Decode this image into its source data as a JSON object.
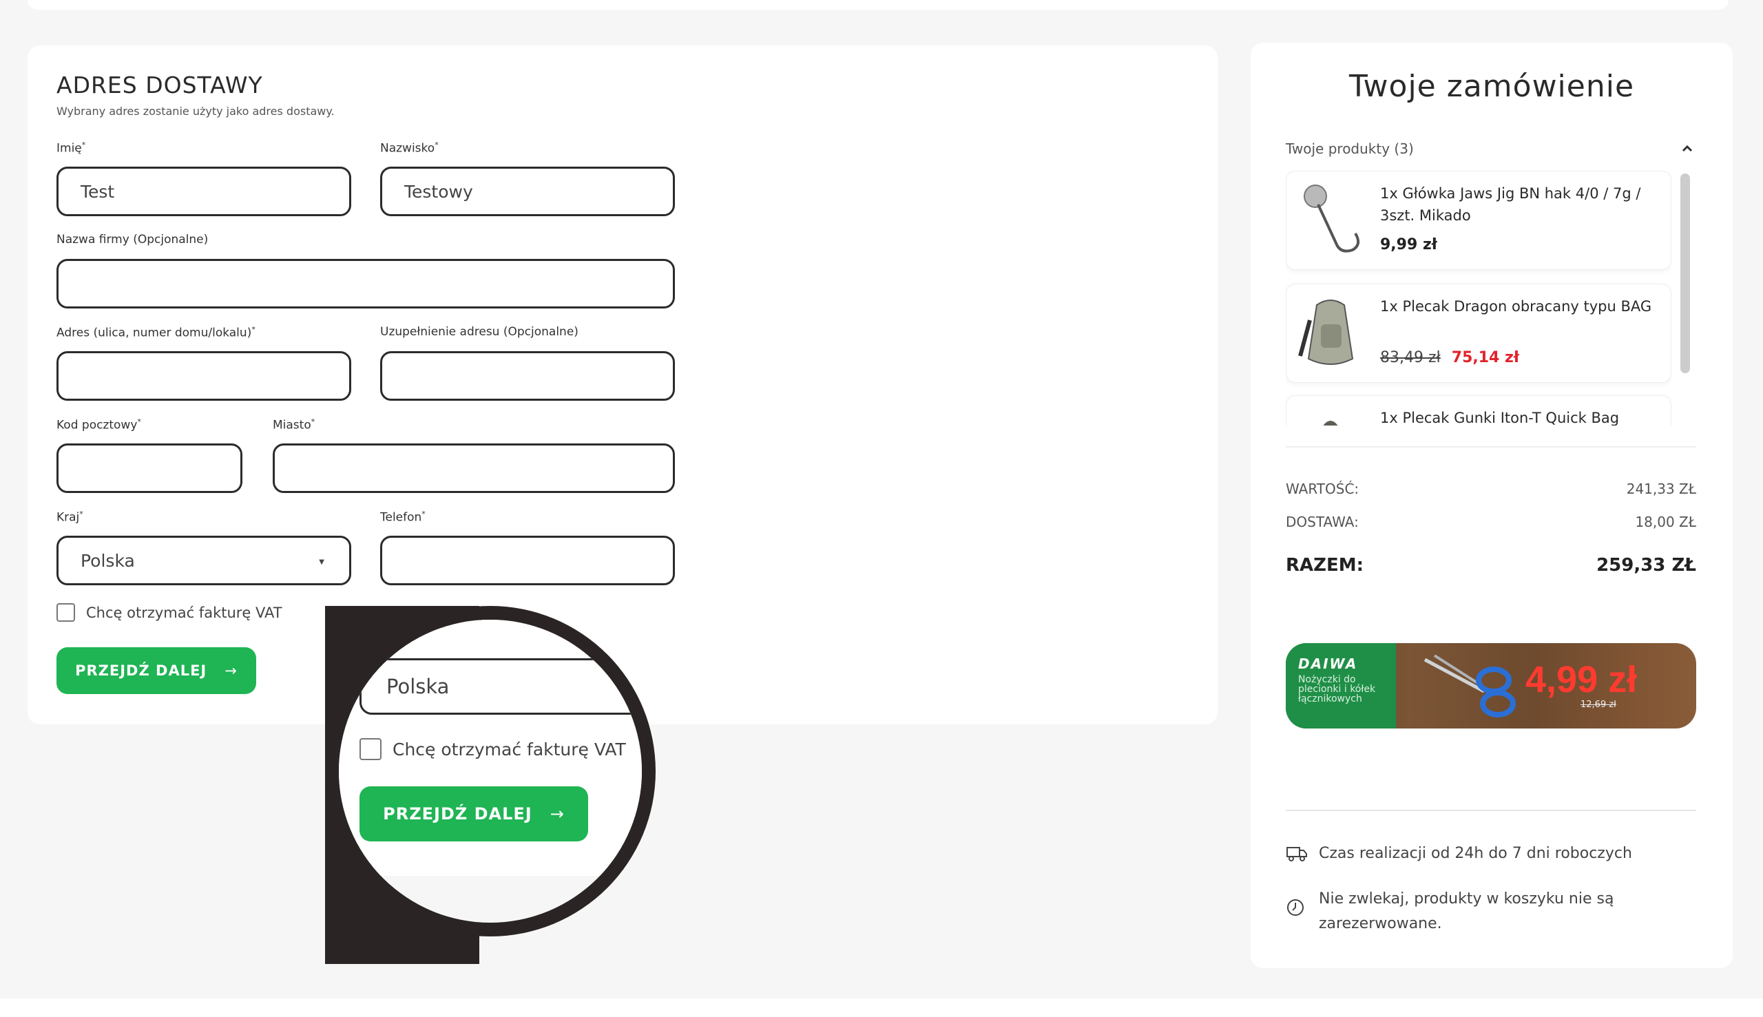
{
  "form": {
    "title": "ADRES DOSTAWY",
    "subtitle": "Wybrany adres zostanie użyty jako adres dostawy.",
    "fields": {
      "first_name": {
        "label": "Imię",
        "value": "Test"
      },
      "last_name": {
        "label": "Nazwisko",
        "value": "Testowy"
      },
      "company": {
        "label": "Nazwa firmy (Opcjonalne)",
        "value": ""
      },
      "address": {
        "label": "Adres (ulica, numer domu/lokalu)",
        "value": ""
      },
      "address2": {
        "label": "Uzupełnienie adresu (Opcjonalne)",
        "value": ""
      },
      "postal_code": {
        "label": "Kod pocztowy",
        "value": ""
      },
      "city": {
        "label": "Miasto",
        "value": ""
      },
      "country": {
        "label": "Kraj",
        "value": "Polska"
      },
      "phone": {
        "label": "Telefon",
        "value": ""
      }
    },
    "required_mark": "*",
    "vat_checkbox_label": "Chcę otrzymać fakturę VAT",
    "submit_label": "PRZEJDŹ DALEJ",
    "arrow": "→"
  },
  "zoom": {
    "country_value": "Polska",
    "vat_checkbox_label": "Chcę otrzymać fakturę VAT",
    "submit_label": "PRZEJDŹ DALEJ",
    "arrow": "→"
  },
  "order": {
    "title": "Twoje zamówienie",
    "products_header": "Twoje produkty (3)",
    "products": [
      {
        "name": "1x Główka Jaws Jig BN hak 4/0 / 7g / 3szt. Mikado",
        "price": "9,99 zł"
      },
      {
        "name": "1x Plecak Dragon obracany typu BAG",
        "old_price": "83,49 zł",
        "sale_price": "75,14 zł"
      },
      {
        "name": "1x Plecak Gunki Iton-T Quick Bag"
      }
    ],
    "summary": {
      "value_label": "WARTOŚĆ:",
      "value": "241,33 ZŁ",
      "shipping_label": "DOSTAWA:",
      "shipping": "18,00 ZŁ",
      "total_label": "RAZEM:",
      "total": "259,33 ZŁ"
    },
    "promo": {
      "brand": "DAIWA",
      "text": "Nożyczki do plecionki i kółek łącznikowych",
      "price": "4,99 zł",
      "old_price": "12,69 zł"
    },
    "info": {
      "delivery": "Czas realizacji od 24h do 7 dni roboczych",
      "reservation": "Nie zwlekaj, produkty w koszyku nie są zarezerwowane."
    }
  },
  "colors": {
    "accent_green": "#1fb454",
    "sale_red": "#e3232c",
    "border_dark": "#2b2b2b"
  },
  "icons": [
    "chevron-up-icon",
    "truck-icon",
    "clock-icon",
    "arrow-right-icon",
    "select-caret-icon"
  ]
}
